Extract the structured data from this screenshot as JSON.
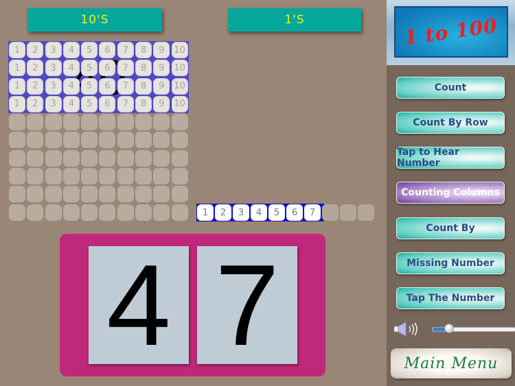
{
  "headers": {
    "tens": "10'S",
    "ones": "1'S"
  },
  "tens_grid": {
    "filled_rows": 4,
    "total_rows": 10,
    "cell_labels": [
      "1",
      "2",
      "3",
      "4",
      "5",
      "6",
      "7",
      "8",
      "9",
      "10"
    ],
    "overlay_value": "40",
    "filled_color": "#4d48c6"
  },
  "ones_strip": {
    "labels": [
      "1",
      "2",
      "3",
      "4",
      "5",
      "6",
      "7"
    ],
    "filled_count": 7,
    "total": 10,
    "filled_color": "#1010c8"
  },
  "number_display": {
    "tens_digit": "4",
    "ones_digit": "7",
    "panel_color": "#c0287a"
  },
  "sidebar": {
    "title": "1 to 100",
    "buttons": [
      {
        "label": "Count",
        "style": "teal"
      },
      {
        "label": "Count By Row",
        "style": "teal"
      },
      {
        "label": "Tap to Hear Number",
        "style": "teal"
      },
      {
        "label": "Counting Columns",
        "style": "purple",
        "selected": true
      },
      {
        "label": "Count By",
        "style": "teal"
      },
      {
        "label": "Missing Number",
        "style": "teal"
      },
      {
        "label": "Tap The Number",
        "style": "teal"
      }
    ],
    "volume": {
      "icon": "speaker-icon",
      "level": 0.2
    },
    "main_menu_label": "Main Menu"
  }
}
